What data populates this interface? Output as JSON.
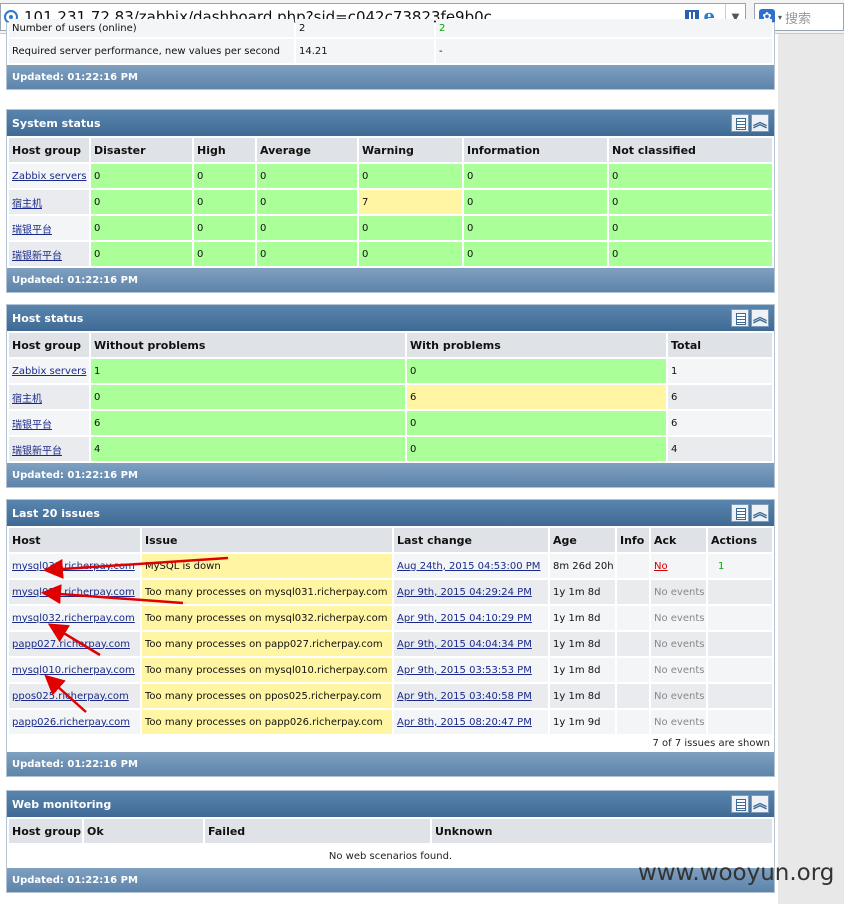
{
  "browser": {
    "url": "101.231.72.83/zabbix/dashboard.php?sid=c042c73823fe9b0c",
    "search_placeholder": "搜索"
  },
  "top_widget": {
    "rows": [
      {
        "label": "Number of users (online)",
        "value": "2",
        "value2": "2"
      },
      {
        "label": "Required server performance, new values per second",
        "value": "14.21",
        "value2": "-"
      }
    ],
    "updated": "Updated: 01:22:16 PM"
  },
  "system_status": {
    "title": "System status",
    "headers": [
      "Host group",
      "Disaster",
      "High",
      "Average",
      "Warning",
      "Information",
      "Not classified"
    ],
    "rows": [
      {
        "group": "Zabbix servers",
        "values": [
          "0",
          "0",
          "0",
          "0",
          "0",
          "0"
        ]
      },
      {
        "group": "宿主机",
        "values": [
          "0",
          "0",
          "0",
          "7",
          "0",
          "0"
        ]
      },
      {
        "group": "瑞银平台",
        "values": [
          "0",
          "0",
          "0",
          "0",
          "0",
          "0"
        ]
      },
      {
        "group": "瑞银新平台",
        "values": [
          "0",
          "0",
          "0",
          "0",
          "0",
          "0"
        ]
      }
    ],
    "updated": "Updated: 01:22:16 PM"
  },
  "host_status": {
    "title": "Host status",
    "headers": [
      "Host group",
      "Without problems",
      "With problems",
      "Total"
    ],
    "rows": [
      {
        "group": "Zabbix servers",
        "ok": "1",
        "problems": "0",
        "total": "1"
      },
      {
        "group": "宿主机",
        "ok": "0",
        "problems": "6",
        "total": "6"
      },
      {
        "group": "瑞银平台",
        "ok": "6",
        "problems": "0",
        "total": "6"
      },
      {
        "group": "瑞银新平台",
        "ok": "4",
        "problems": "0",
        "total": "4"
      }
    ],
    "updated": "Updated: 01:22:16 PM"
  },
  "last_issues": {
    "title": "Last 20 issues",
    "headers": [
      "Host",
      "Issue",
      "Last change",
      "Age",
      "Info",
      "Ack",
      "Actions"
    ],
    "rows": [
      {
        "host": "mysql033.richerpay.com",
        "issue": "MySQL is down",
        "last_change": "Aug 24th, 2015 04:53:00 PM",
        "age": "8m 26d 20h",
        "info": "",
        "ack": "No",
        "actions": "1"
      },
      {
        "host": "mysql031.richerpay.com",
        "issue": "Too many processes on mysql031.richerpay.com",
        "last_change": "Apr 9th, 2015 04:29:24 PM",
        "age": "1y 1m 8d",
        "info": "",
        "ack": "No events",
        "actions": ""
      },
      {
        "host": "mysql032.richerpay.com",
        "issue": "Too many processes on mysql032.richerpay.com",
        "last_change": "Apr 9th, 2015 04:10:29 PM",
        "age": "1y 1m 8d",
        "info": "",
        "ack": "No events",
        "actions": ""
      },
      {
        "host": "papp027.richerpay.com",
        "issue": "Too many processes on papp027.richerpay.com",
        "last_change": "Apr 9th, 2015 04:04:34 PM",
        "age": "1y 1m 8d",
        "info": "",
        "ack": "No events",
        "actions": ""
      },
      {
        "host": "mysql010.richerpay.com",
        "issue": "Too many processes on mysql010.richerpay.com",
        "last_change": "Apr 9th, 2015 03:53:53 PM",
        "age": "1y 1m 8d",
        "info": "",
        "ack": "No events",
        "actions": ""
      },
      {
        "host": "ppos025.richerpay.com",
        "issue": "Too many processes on ppos025.richerpay.com",
        "last_change": "Apr 9th, 2015 03:40:58 PM",
        "age": "1y 1m 8d",
        "info": "",
        "ack": "No events",
        "actions": ""
      },
      {
        "host": "papp026.richerpay.com",
        "issue": "Too many processes on papp026.richerpay.com",
        "last_change": "Apr 8th, 2015 08:20:47 PM",
        "age": "1y 1m 9d",
        "info": "",
        "ack": "No events",
        "actions": ""
      }
    ],
    "shown": "7 of 7 issues are shown",
    "updated": "Updated: 01:22:16 PM"
  },
  "web_monitoring": {
    "title": "Web monitoring",
    "headers": [
      "Host group",
      "Ok",
      "Failed",
      "Unknown"
    ],
    "empty": "No web scenarios found.",
    "updated": "Updated: 01:22:16 PM"
  },
  "watermark": "www.wooyun.org",
  "colors": {
    "ok": "#aaff99",
    "warning": "#fff5a3",
    "header": "#3f6a95",
    "arrow": "#e00000"
  }
}
